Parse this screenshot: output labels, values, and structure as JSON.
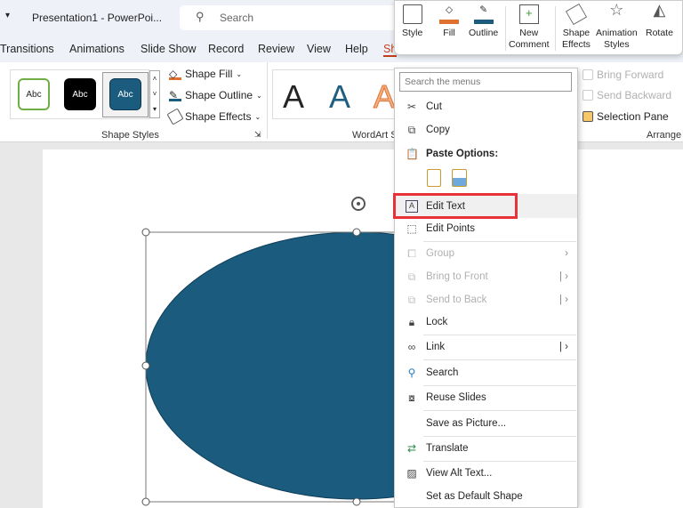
{
  "titlebar": {
    "title": "Presentation1  -  PowerPoi...",
    "search_placeholder": "Search"
  },
  "tabs": [
    "Transitions",
    "Animations",
    "Slide Show",
    "Record",
    "Review",
    "View",
    "Help",
    "Sh"
  ],
  "ribbon": {
    "shape_styles": {
      "swatches": [
        "Abc",
        "Abc",
        "Abc"
      ],
      "fill": "Shape Fill",
      "outline": "Shape Outline",
      "effects": "Shape Effects",
      "label": "Shape Styles"
    },
    "wordart": {
      "letters": [
        "A",
        "A",
        "A"
      ],
      "label": "WordArt S"
    },
    "arrange": {
      "bring_forward": "Bring Forward",
      "send_backward": "Send Backward",
      "selection_pane": "Selection Pane",
      "label": "Arrange"
    }
  },
  "mini_toolbar": [
    {
      "label": "Style"
    },
    {
      "label": "Fill"
    },
    {
      "label": "Outline"
    },
    {
      "label": "New\nComment"
    },
    {
      "label": "Shape\nEffects"
    },
    {
      "label": "Animation\nStyles"
    },
    {
      "label": "Rotate"
    }
  ],
  "context_menu": {
    "search_placeholder": "Search the menus",
    "items": [
      {
        "label": "Cut",
        "icon": "cut-icon"
      },
      {
        "label": "Copy",
        "icon": "copy-icon"
      },
      {
        "label": "Paste Options:",
        "icon": "paste-icon"
      },
      {
        "label": "Edit Text",
        "icon": "edit-text-icon"
      },
      {
        "label": "Edit Points",
        "icon": "edit-points-icon"
      },
      {
        "label": "Group",
        "icon": "group-icon"
      },
      {
        "label": "Bring to Front",
        "icon": "bring-front-icon"
      },
      {
        "label": "Send to Back",
        "icon": "send-back-icon"
      },
      {
        "label": "Lock",
        "icon": "lock-icon"
      },
      {
        "label": "Link",
        "icon": "link-icon"
      },
      {
        "label": "Search",
        "icon": "search-icon"
      },
      {
        "label": "Reuse Slides",
        "icon": "reuse-slides-icon"
      },
      {
        "label": "Save as Picture...",
        "icon": ""
      },
      {
        "label": "Translate",
        "icon": "translate-icon"
      },
      {
        "label": "View Alt Text...",
        "icon": "alt-text-icon"
      },
      {
        "label": "Set as Default Shape",
        "icon": ""
      }
    ]
  },
  "colors": {
    "shape_fill": "#1a5b7e",
    "highlight_box": "#e8323a",
    "accent": "#c43e1c"
  }
}
